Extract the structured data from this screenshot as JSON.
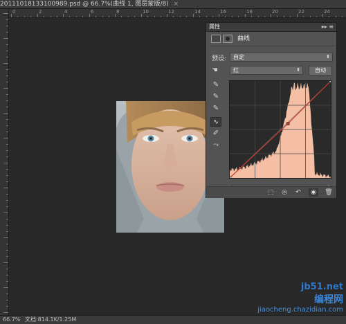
{
  "document": {
    "tab_title": "20111018133100989.psd @ 66.7%(曲线 1, 图层蒙版/8)",
    "close_glyph": "×",
    "ruler_numbers": [
      "0",
      "2",
      "4",
      "6",
      "8",
      "10",
      "12",
      "14",
      "16",
      "18",
      "20",
      "22",
      "24"
    ]
  },
  "status": {
    "zoom": "66.7%",
    "doc_info": "文档:814.1K/1.25M"
  },
  "panel": {
    "tab_label": "属性",
    "collapse_glyph": "▸▸",
    "menu_glyph": "≡",
    "title": "曲线",
    "preset_label": "预设:",
    "preset_value": "自定",
    "channel_value": "红",
    "auto_button": "自动",
    "tools": [
      {
        "name": "sample-shadow-eyedropper-icon",
        "glyph": "✎"
      },
      {
        "name": "sample-midtone-eyedropper-icon",
        "glyph": "✎"
      },
      {
        "name": "sample-highlight-eyedropper-icon",
        "glyph": "✎"
      },
      {
        "name": "curve-point-tool-icon",
        "glyph": "∿"
      },
      {
        "name": "pencil-draw-icon",
        "glyph": "✐"
      },
      {
        "name": "smooth-curve-icon",
        "glyph": "⤳"
      }
    ],
    "bottom_tools": [
      {
        "name": "clip-to-layer-icon",
        "glyph": "⬚"
      },
      {
        "name": "view-previous-state-icon",
        "glyph": "◎"
      },
      {
        "name": "reset-adjustment-icon",
        "glyph": "↶"
      },
      {
        "name": "visibility-eye-icon",
        "glyph": "◉"
      },
      {
        "name": "delete-adjustment-icon",
        "glyph": "🗑"
      }
    ]
  },
  "curve": {
    "channel_color": "#c0392b",
    "histogram_color": "#f4bfa4",
    "points_input": [
      0,
      147,
      255
    ],
    "points_output": [
      0,
      143,
      255
    ]
  },
  "watermark": {
    "site": "jb51.net",
    "brand": "编程网",
    "sub": "jiaocheng.chazidian.com"
  }
}
